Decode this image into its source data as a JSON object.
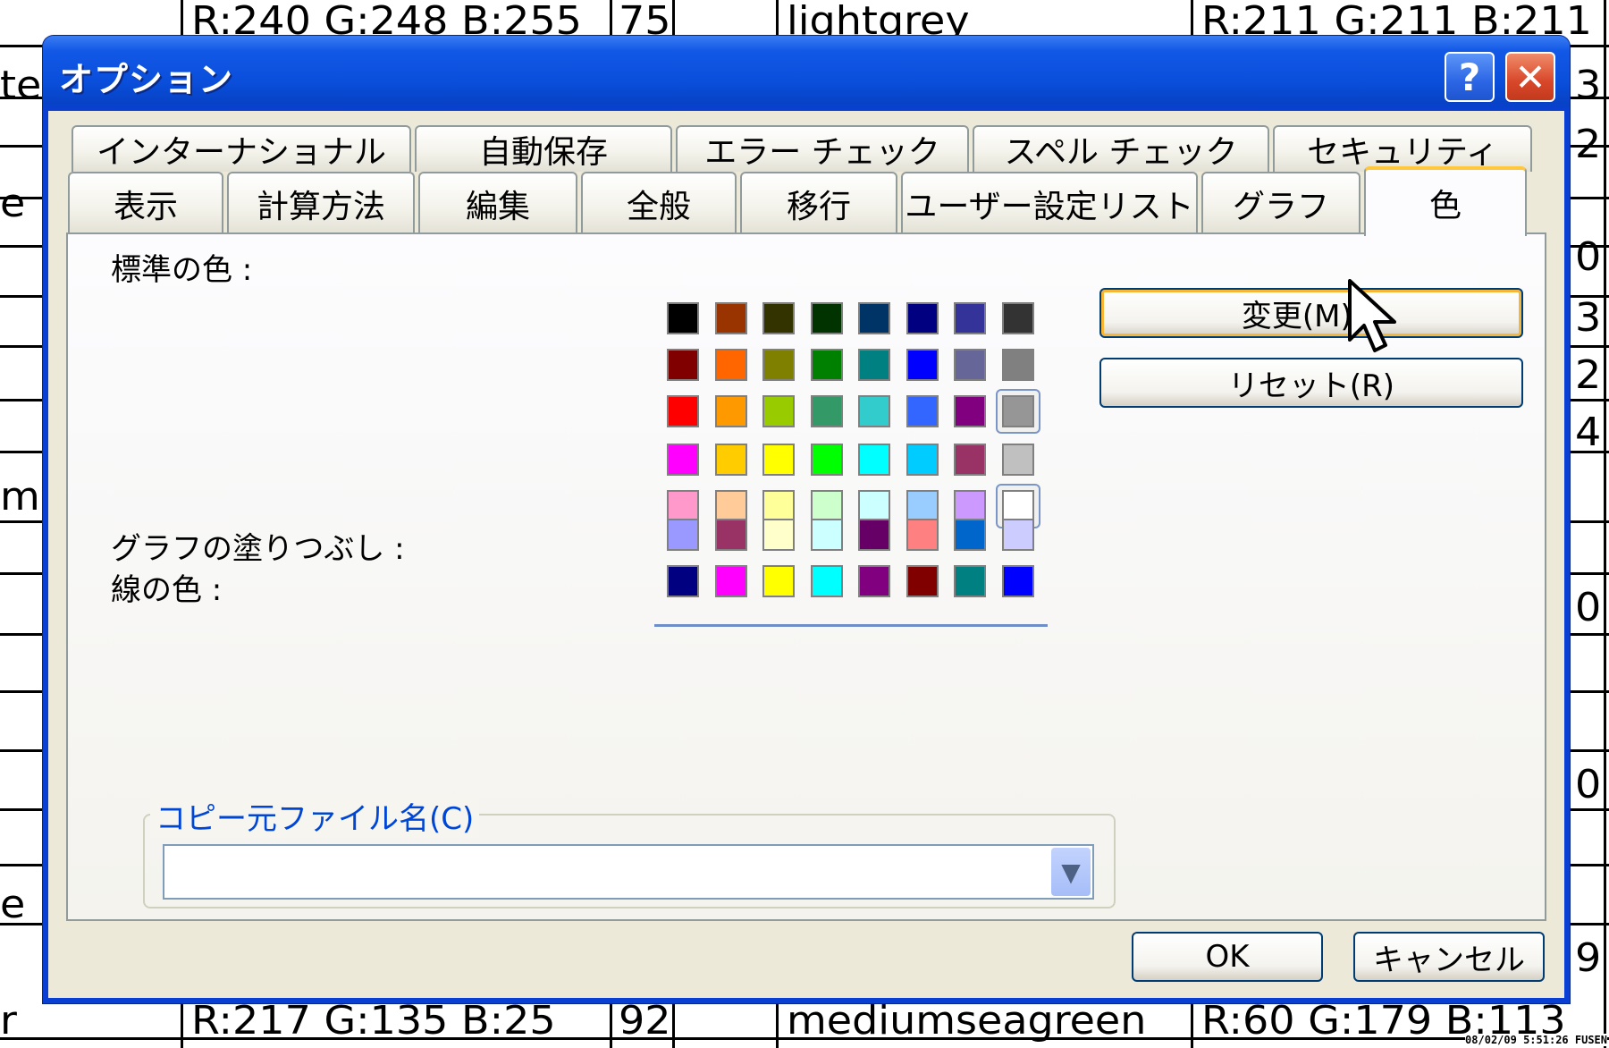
{
  "background_sheet": {
    "top_row": [
      "R:240 G:248 B:255",
      "75",
      "lightgrey",
      "R:211 G:211 B:211"
    ],
    "bottom_row": [
      "R:217 G:135 B:25",
      "92",
      "mediumseagreen",
      "R:60 G:179 B:113"
    ],
    "left_fragments": [
      "te",
      "e",
      "me",
      "e",
      "r"
    ],
    "right_fragments": [
      "3",
      "2",
      "0",
      "3",
      "2",
      "4",
      "0",
      "0",
      "9"
    ],
    "timestamp": "08/02/09 5:51:26 FUSEN"
  },
  "dialog": {
    "title": "オプション",
    "help_label": "?",
    "close_label": "✕",
    "tabs_back_row": [
      "インターナショナル",
      "自動保存",
      "エラー チェック",
      "スペル チェック",
      "セキュリティ"
    ],
    "tabs_front_row": [
      "表示",
      "計算方法",
      "編集",
      "全般",
      "移行",
      "ユーザー設定リスト",
      "グラフ",
      "色"
    ],
    "active_tab": "色",
    "standard_colors_label": "標準の色 :",
    "chart_fill_label": "グラフの塗りつぶし :",
    "line_color_label": "線の色 :",
    "modify_button": "変更(M)...",
    "reset_button": "リセット(R)",
    "copy_source_label": "コピー元ファイル名(C)",
    "copy_source_value": "",
    "ok_button": "OK",
    "cancel_button": "キャンセル"
  },
  "palette": {
    "standard": [
      [
        "#000000",
        "#993300",
        "#333300",
        "#003300",
        "#003366",
        "#000080",
        "#333399",
        "#333333"
      ],
      [
        "#800000",
        "#ff6600",
        "#808000",
        "#008000",
        "#008080",
        "#0000ff",
        "#666699",
        "#808080"
      ],
      [
        "#ff0000",
        "#ff9900",
        "#99cc00",
        "#339966",
        "#33cccc",
        "#3366ff",
        "#800080",
        "#969696"
      ],
      [
        "#ff00ff",
        "#ffcc00",
        "#ffff00",
        "#00ff00",
        "#00ffff",
        "#00ccff",
        "#993366",
        "#c0c0c0"
      ],
      [
        "#ff99cc",
        "#ffcc99",
        "#ffff99",
        "#ccffcc",
        "#ccffff",
        "#99ccff",
        "#cc99ff",
        "#ffffff"
      ]
    ],
    "chart_fill": [
      "#9999ff",
      "#993366",
      "#ffffcc",
      "#ccffff",
      "#660066",
      "#ff8080",
      "#0066cc",
      "#ccccff"
    ],
    "chart_line": [
      "#000080",
      "#ff00ff",
      "#ffff00",
      "#00ffff",
      "#800080",
      "#800000",
      "#008080",
      "#0000ff"
    ],
    "selected": [
      "standard:2:7",
      "standard:4:7"
    ]
  }
}
